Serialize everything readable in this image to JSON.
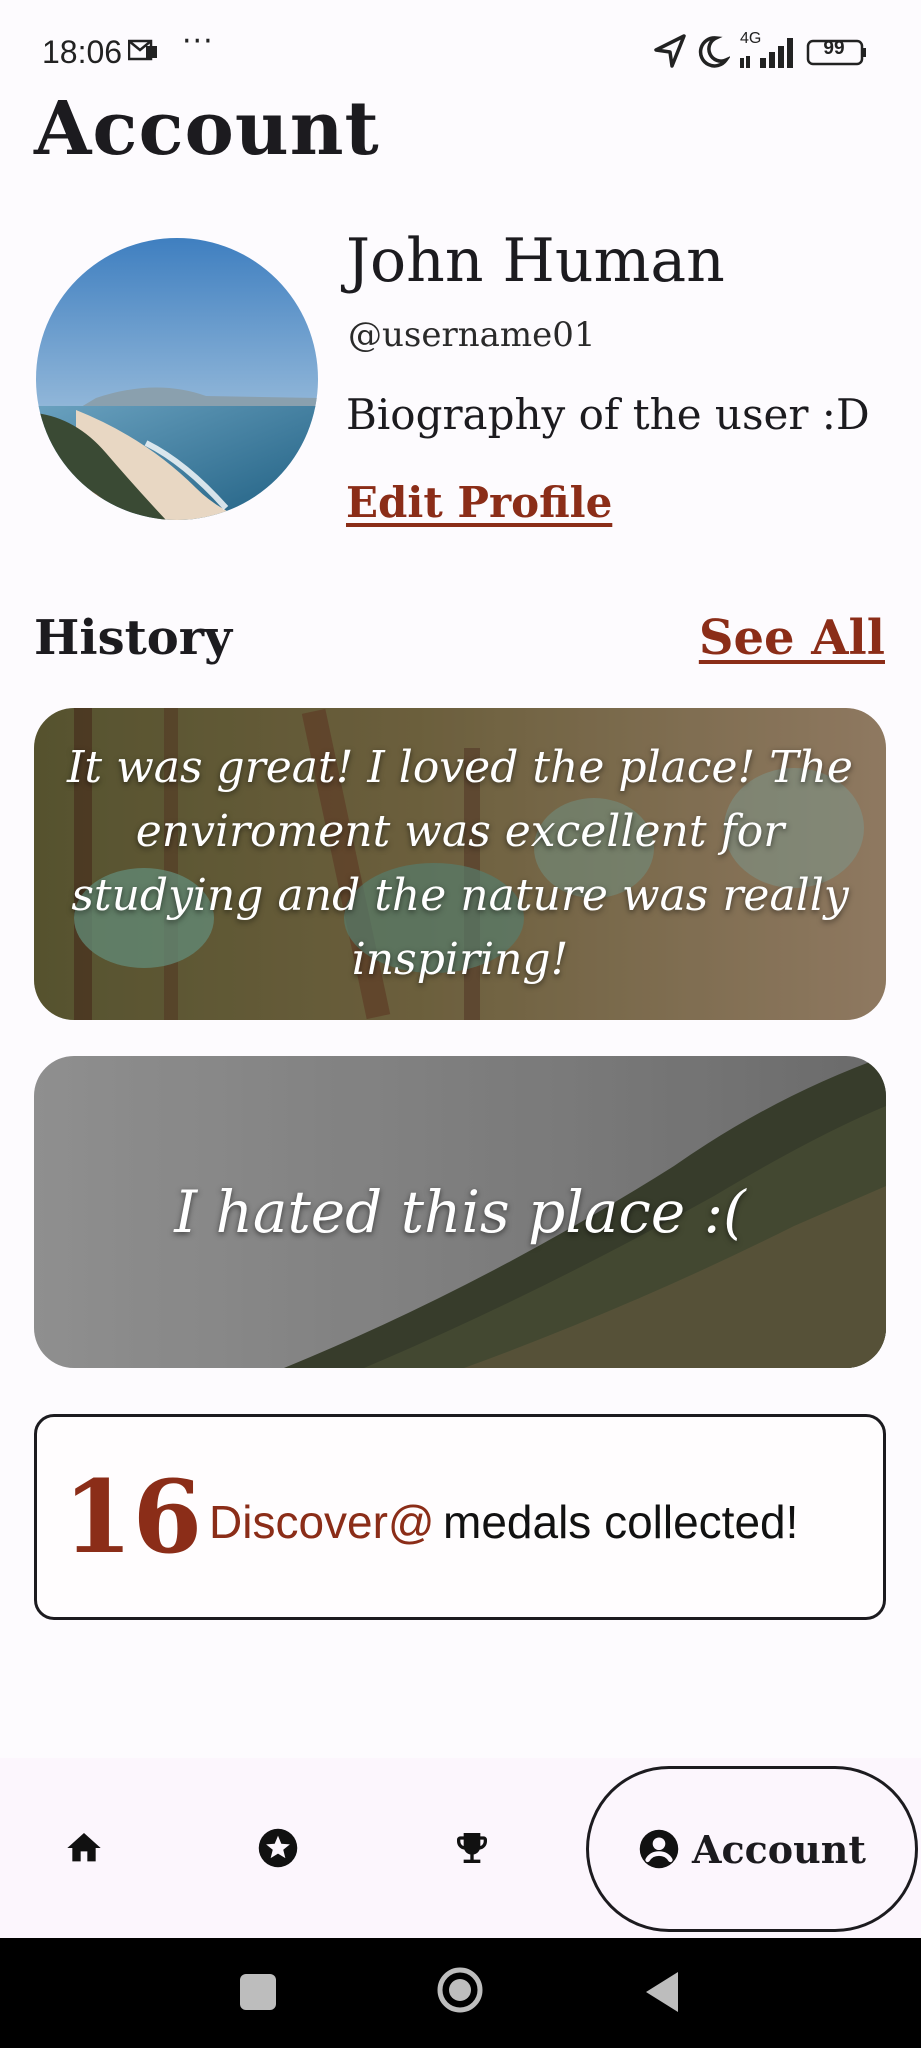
{
  "status_bar": {
    "time": "18:06",
    "dots": "···",
    "network": "4G",
    "battery": "99"
  },
  "page": {
    "title": "Account"
  },
  "profile": {
    "name": "John Human",
    "username": "@username01",
    "bio": "Biography of the user :D",
    "edit_label": "Edit Profile"
  },
  "history": {
    "title": "History",
    "see_all_label": "See All",
    "items": [
      {
        "text": "It was great! I loved the place! The enviroment was excellent for studying and the nature was really inspiring!"
      },
      {
        "text": "I hated this place :("
      }
    ]
  },
  "medals": {
    "count": "16",
    "brand": "Discover@",
    "text": "medals collected!"
  },
  "bottom_nav": {
    "items": [
      {
        "icon": "home-icon"
      },
      {
        "icon": "star-icon"
      },
      {
        "icon": "trophy-icon"
      },
      {
        "icon": "account-icon",
        "label": "Account"
      }
    ]
  },
  "colors": {
    "accent": "#8b2d18",
    "background": "#fdfbfe",
    "text": "#1c1b1f"
  }
}
